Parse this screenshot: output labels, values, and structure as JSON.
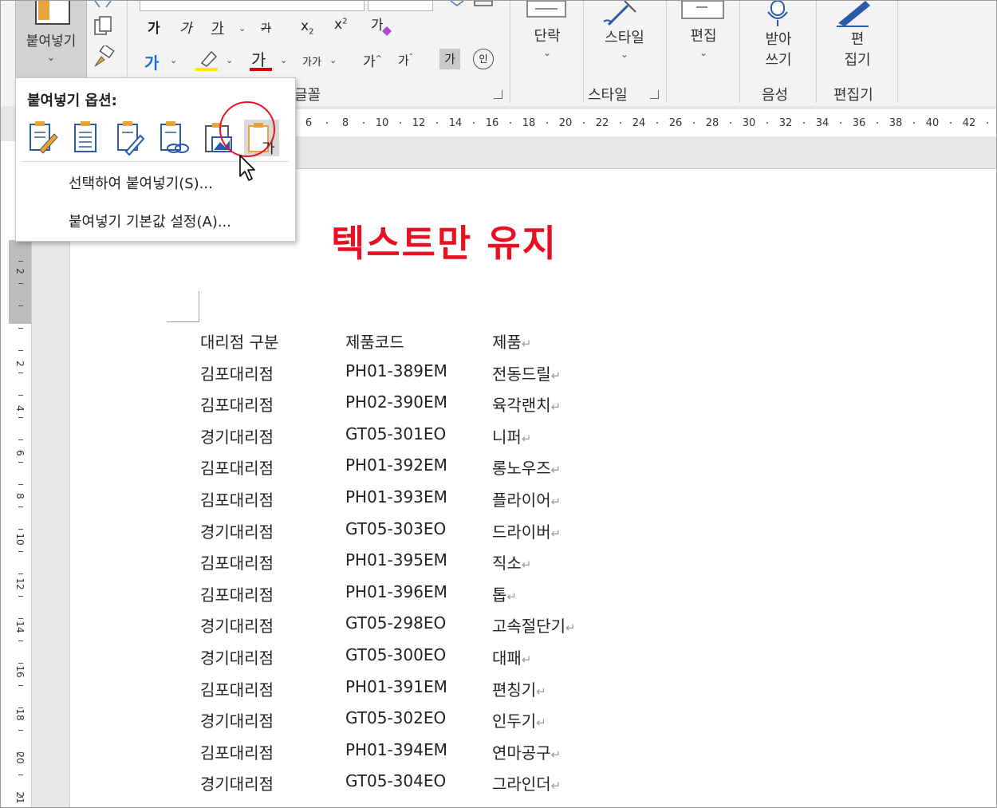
{
  "ribbon": {
    "clipboard": {
      "paste_label": "붙여넣기",
      "chevron": "⌄"
    },
    "font_row1": [
      "가",
      "가",
      "가",
      "가",
      "x",
      "x",
      "가"
    ],
    "font_row2_small": "가가",
    "font_row2_grow": "가",
    "font_row2_shrink": "가",
    "font_row2_gray": "가",
    "font_row2_circle": "인",
    "font_group_label": "글꼴",
    "paragraph_label": "단락",
    "styles_label": "스타일",
    "styles_group_label": "스타일",
    "editing_label": "편집",
    "dictate_label_1": "받아",
    "dictate_label_2": "쓰기",
    "voice_group_label": "음성",
    "editor_label_1": "편",
    "editor_label_2": "집기",
    "editor_group_label": "편집기",
    "chev": "⌄",
    "font_color_a": "가",
    "highlight_a": "가"
  },
  "ruler": {
    "numbers": [
      "6",
      "8",
      "10",
      "12",
      "14",
      "16",
      "18",
      "20",
      "22",
      "24",
      "26",
      "28",
      "30",
      "32",
      "34",
      "36",
      "38",
      "40",
      "42"
    ],
    "vertical_numbers": [
      "2",
      "2",
      "4",
      "6",
      "8",
      "10",
      "12",
      "14",
      "16",
      "18",
      "20",
      "21"
    ]
  },
  "paste_menu": {
    "title": "붙여넣기 옵션:",
    "items": [
      "선택하여 붙여넣기(S)...",
      "붙여넣기 기본값 설정(A)..."
    ],
    "icon_names": [
      "keep-source-formatting",
      "merge-formatting",
      "use-destination-styles",
      "link-keep-source",
      "picture",
      "keep-text-only"
    ],
    "text_only_glyph": "가"
  },
  "document": {
    "banner": "텍스트만 유지",
    "banner_color": "#e81123",
    "para_mark": "↵",
    "header": [
      "대리점 구분",
      "제품코드",
      "제품"
    ],
    "rows": [
      [
        "김포대리점",
        "PH01-389EM",
        "전동드릴"
      ],
      [
        "김포대리점",
        "PH02-390EM",
        "육각랜치"
      ],
      [
        "경기대리점",
        "GT05-301EO",
        "니퍼"
      ],
      [
        "김포대리점",
        "PH01-392EM",
        "롱노우즈"
      ],
      [
        "김포대리점",
        "PH01-393EM",
        "플라이어"
      ],
      [
        "경기대리점",
        "GT05-303EO",
        "드라이버"
      ],
      [
        "김포대리점",
        "PH01-395EM",
        "직소"
      ],
      [
        "김포대리점",
        "PH01-396EM",
        "톱"
      ],
      [
        "경기대리점",
        "GT05-298EO",
        "고속절단기"
      ],
      [
        "경기대리점",
        "GT05-300EO",
        "대패"
      ],
      [
        "김포대리점",
        "PH01-391EM",
        "편칭기"
      ],
      [
        "경기대리점",
        "GT05-302EO",
        "인두기"
      ],
      [
        "김포대리점",
        "PH01-394EM",
        "연마공구"
      ],
      [
        "경기대리점",
        "GT05-304EO",
        "그라인더"
      ]
    ]
  }
}
